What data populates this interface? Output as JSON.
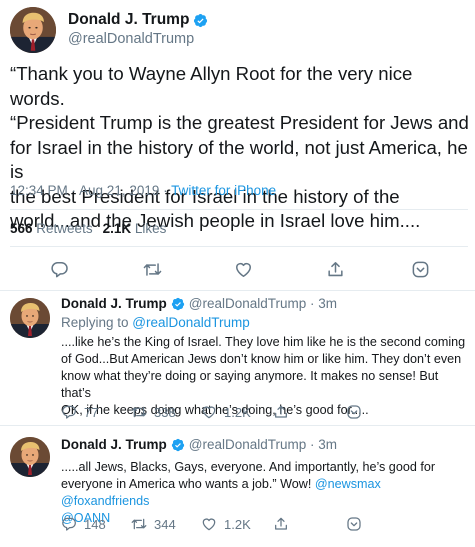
{
  "main": {
    "name": "Donald J. Trump",
    "handle": "@realDonaldTrump",
    "text_lines": [
      "“Thank you to Wayne Allyn Root for the very nice words.",
      "“President Trump is the greatest President for Jews and",
      "for Israel in the history of the world, not just America, he is",
      "the best President for Israel in the history of the",
      "world...and the Jewish people in Israel love him...."
    ],
    "timestamp": "12:34 PM · Aug 21, 2019 · ",
    "source": "Twitter for iPhone",
    "retweets_count": "566",
    "retweets_label": "Retweets",
    "likes_count": "2.1K",
    "likes_label": "Likes"
  },
  "replies": [
    {
      "name": "Donald J. Trump",
      "handle_time": "@realDonaldTrump · 3m",
      "replying_prefix": "Replying to ",
      "replying_to": "@realDonaldTrump",
      "text_lines": [
        "....like he’s the King of Israel. They love him like he is the second coming",
        "of God...But American Jews don’t know him or like him. They don’t even",
        "know what they’re doing or saying anymore. It makes no sense! But that’s",
        "OK, if he keeps doing what he’s doing, he’s good for....."
      ],
      "replies_count": "77",
      "retweets_count": "338",
      "likes_count": "1.2K"
    },
    {
      "name": "Donald J. Trump",
      "handle_time": "@realDonaldTrump · 3m",
      "text_line1": ".....all Jews, Blacks, Gays, everyone. And importantly, he’s good for",
      "text_line2_plain": "everyone in America who wants a job.” Wow! ",
      "mention_newsmax": "@newsmax",
      "mention_foxandfriends": "@foxandfriends",
      "mention_oann": "@OANN",
      "replies_count": "148",
      "retweets_count": "344",
      "likes_count": "1.2K"
    }
  ],
  "colors": {
    "accent": "#1b95e0",
    "secondary_text": "#657786",
    "primary_text": "#14171a",
    "divider": "#e6ecf0"
  },
  "icons": [
    "verified-badge-icon",
    "reply-icon",
    "retweet-icon",
    "like-icon",
    "share-icon",
    "chevron-down-icon"
  ]
}
